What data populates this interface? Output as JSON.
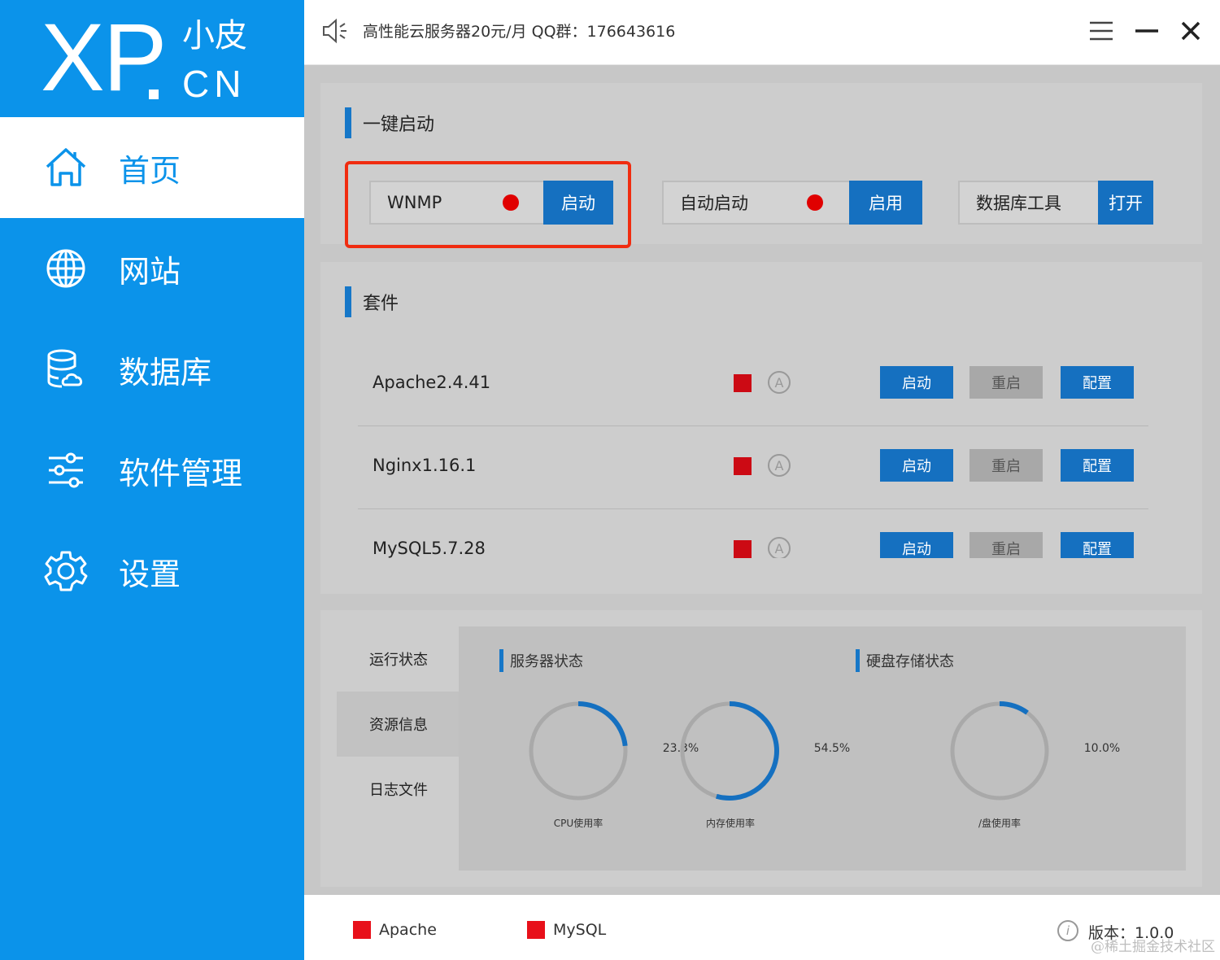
{
  "logo": {
    "brand": "XP",
    "dot": ".",
    "chinese": "小皮",
    "domain": "CN"
  },
  "sidebar": {
    "items": [
      {
        "label": "首页",
        "icon": "home-icon",
        "active": true
      },
      {
        "label": "网站",
        "icon": "globe-icon",
        "active": false
      },
      {
        "label": "数据库",
        "icon": "database-icon",
        "active": false
      },
      {
        "label": "软件管理",
        "icon": "sliders-icon",
        "active": false
      },
      {
        "label": "设置",
        "icon": "gear-icon",
        "active": false
      }
    ]
  },
  "topbar": {
    "ad_text": "高性能云服务器20元/月  QQ群：176643616",
    "icons": [
      "speaker-icon",
      "menu-icon",
      "minimize-icon",
      "close-icon"
    ]
  },
  "quick_start": {
    "title": "一键启动",
    "items": [
      {
        "label": "WNMP",
        "button": "启动",
        "status": "stopped"
      },
      {
        "label": "自动启动",
        "button": "启用",
        "status": "stopped"
      },
      {
        "label": "数据库工具",
        "button": "打开"
      }
    ]
  },
  "suite": {
    "title": "套件",
    "rows": [
      {
        "name": "Apache2.4.41",
        "start": "启动",
        "restart": "重启",
        "config": "配置",
        "auto_glyph": "A"
      },
      {
        "name": "Nginx1.16.1",
        "start": "启动",
        "restart": "重启",
        "config": "配置",
        "auto_glyph": "A"
      },
      {
        "name": "MySQL5.7.28",
        "start": "启动",
        "restart": "重启",
        "config": "配置",
        "auto_glyph": "A"
      }
    ]
  },
  "status": {
    "tabs": [
      {
        "label": "运行状态",
        "active": false
      },
      {
        "label": "资源信息",
        "active": true
      },
      {
        "label": "日志文件",
        "active": false
      }
    ],
    "server_title": "服务器状态",
    "disk_title": "硬盘存储状态",
    "gauges": [
      {
        "value": "23.3%",
        "fraction": 0.233,
        "label": "CPU使用率"
      },
      {
        "value": "54.5%",
        "fraction": 0.545,
        "label": "内存使用率"
      },
      {
        "value": "10.0%",
        "fraction": 0.1,
        "label": "/盘使用率"
      }
    ]
  },
  "footer": {
    "legend": [
      {
        "label": "Apache",
        "color": "#e8101a"
      },
      {
        "label": "MySQL",
        "color": "#e8101a"
      }
    ],
    "info_glyph": "i",
    "version": "版本：1.0.0",
    "watermark": "@稀土掘金技术社区"
  },
  "colors": {
    "sidebar": "#0b93ea",
    "accent_blue": "#1570c0",
    "stopped_red": "#e00000",
    "highlight_border": "#f02c10"
  }
}
